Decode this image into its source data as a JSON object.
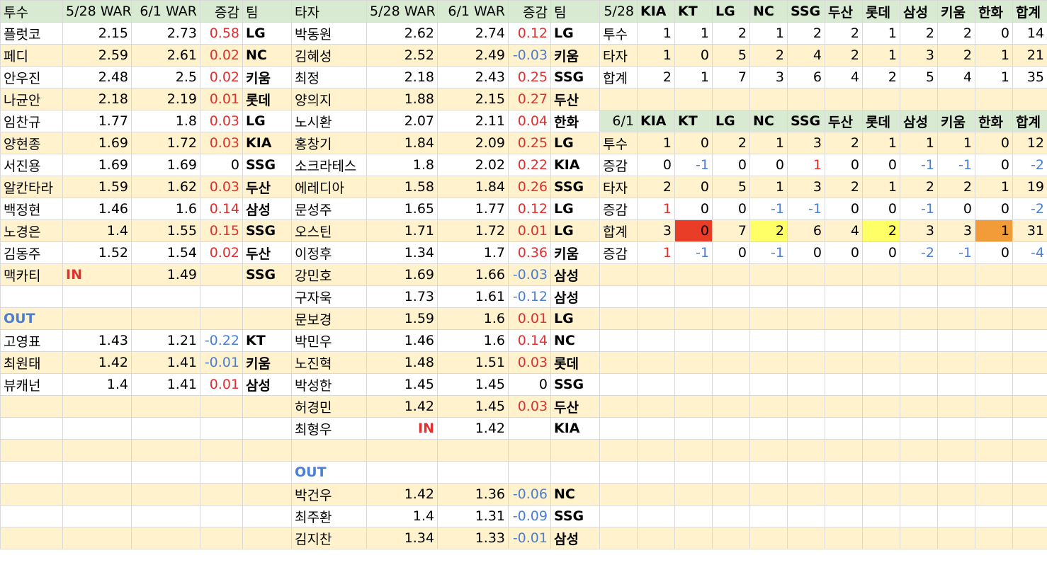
{
  "pitchers": {
    "headers": [
      "투수",
      "5/28 WAR",
      "6/1 WAR",
      "증감",
      "팀"
    ],
    "rows": [
      {
        "name": "플럿코",
        "w1": "2.15",
        "w2": "2.73",
        "diff": "0.58",
        "team": "LG"
      },
      {
        "name": "페디",
        "w1": "2.59",
        "w2": "2.61",
        "diff": "0.02",
        "team": "NC"
      },
      {
        "name": "안우진",
        "w1": "2.48",
        "w2": "2.5",
        "diff": "0.02",
        "team": "키움"
      },
      {
        "name": "나균안",
        "w1": "2.18",
        "w2": "2.19",
        "diff": "0.01",
        "team": "롯데"
      },
      {
        "name": "임찬규",
        "w1": "1.77",
        "w2": "1.8",
        "diff": "0.03",
        "team": "LG"
      },
      {
        "name": "양현종",
        "w1": "1.69",
        "w2": "1.72",
        "diff": "0.03",
        "team": "KIA"
      },
      {
        "name": "서진용",
        "w1": "1.69",
        "w2": "1.69",
        "diff": "0",
        "team": "SSG"
      },
      {
        "name": "알칸타라",
        "w1": "1.59",
        "w2": "1.62",
        "diff": "0.03",
        "team": "두산"
      },
      {
        "name": "백정현",
        "w1": "1.46",
        "w2": "1.6",
        "diff": "0.14",
        "team": "삼성"
      },
      {
        "name": "노경은",
        "w1": "1.4",
        "w2": "1.55",
        "diff": "0.15",
        "team": "SSG"
      },
      {
        "name": "김동주",
        "w1": "1.52",
        "w2": "1.54",
        "diff": "0.02",
        "team": "두산"
      },
      {
        "name": "맥카티",
        "w1": "IN",
        "w2": "1.49",
        "diff": "",
        "team": "SSG"
      }
    ],
    "out_label": "OUT",
    "out_rows": [
      {
        "name": "고영표",
        "w1": "1.43",
        "w2": "1.21",
        "diff": "-0.22",
        "team": "KT"
      },
      {
        "name": "최원태",
        "w1": "1.42",
        "w2": "1.41",
        "diff": "-0.01",
        "team": "키움"
      },
      {
        "name": "뷰캐넌",
        "w1": "1.4",
        "w2": "1.41",
        "diff": "0.01",
        "team": "삼성"
      }
    ]
  },
  "batters": {
    "headers": [
      "타자",
      "5/28 WAR",
      "6/1 WAR",
      "증감",
      "팀"
    ],
    "rows": [
      {
        "name": "박동원",
        "w1": "2.62",
        "w2": "2.74",
        "diff": "0.12",
        "team": "LG"
      },
      {
        "name": "김혜성",
        "w1": "2.52",
        "w2": "2.49",
        "diff": "-0.03",
        "team": "키움"
      },
      {
        "name": "최정",
        "w1": "2.18",
        "w2": "2.43",
        "diff": "0.25",
        "team": "SSG"
      },
      {
        "name": "양의지",
        "w1": "1.88",
        "w2": "2.15",
        "diff": "0.27",
        "team": "두산"
      },
      {
        "name": "노시환",
        "w1": "2.07",
        "w2": "2.11",
        "diff": "0.04",
        "team": "한화"
      },
      {
        "name": "홍창기",
        "w1": "1.84",
        "w2": "2.09",
        "diff": "0.25",
        "team": "LG"
      },
      {
        "name": "소크라테스",
        "w1": "1.8",
        "w2": "2.02",
        "diff": "0.22",
        "team": "KIA"
      },
      {
        "name": "에레디아",
        "w1": "1.58",
        "w2": "1.84",
        "diff": "0.26",
        "team": "SSG"
      },
      {
        "name": "문성주",
        "w1": "1.65",
        "w2": "1.77",
        "diff": "0.12",
        "team": "LG"
      },
      {
        "name": "오스틴",
        "w1": "1.71",
        "w2": "1.72",
        "diff": "0.01",
        "team": "LG"
      },
      {
        "name": "이정후",
        "w1": "1.34",
        "w2": "1.7",
        "diff": "0.36",
        "team": "키움"
      },
      {
        "name": "강민호",
        "w1": "1.69",
        "w2": "1.66",
        "diff": "-0.03",
        "team": "삼성"
      },
      {
        "name": "구자욱",
        "w1": "1.73",
        "w2": "1.61",
        "diff": "-0.12",
        "team": "삼성"
      },
      {
        "name": "문보경",
        "w1": "1.59",
        "w2": "1.6",
        "diff": "0.01",
        "team": "LG"
      },
      {
        "name": "박민우",
        "w1": "1.46",
        "w2": "1.6",
        "diff": "0.14",
        "team": "NC"
      },
      {
        "name": "노진혁",
        "w1": "1.48",
        "w2": "1.51",
        "diff": "0.03",
        "team": "롯데"
      },
      {
        "name": "박성한",
        "w1": "1.45",
        "w2": "1.45",
        "diff": "0",
        "team": "SSG"
      },
      {
        "name": "허경민",
        "w1": "1.42",
        "w2": "1.45",
        "diff": "0.03",
        "team": "두산"
      },
      {
        "name": "최형우",
        "w1": "IN",
        "w2": "1.42",
        "diff": "",
        "team": "KIA"
      }
    ],
    "out_label": "OUT",
    "out_rows": [
      {
        "name": "박건우",
        "w1": "1.42",
        "w2": "1.36",
        "diff": "-0.06",
        "team": "NC"
      },
      {
        "name": "최주환",
        "w1": "1.4",
        "w2": "1.31",
        "diff": "-0.09",
        "team": "SSG"
      },
      {
        "name": "김지찬",
        "w1": "1.34",
        "w2": "1.33",
        "diff": "-0.01",
        "team": "삼성"
      }
    ]
  },
  "summary_528": {
    "headers": [
      "5/28",
      "KIA",
      "KT",
      "LG",
      "NC",
      "SSG",
      "두산",
      "롯데",
      "삼성",
      "키움",
      "한화",
      "합계"
    ],
    "rows": [
      {
        "label": "투수",
        "values": [
          "1",
          "1",
          "2",
          "1",
          "2",
          "2",
          "1",
          "2",
          "2",
          "0",
          "14"
        ]
      },
      {
        "label": "타자",
        "values": [
          "1",
          "0",
          "5",
          "2",
          "4",
          "2",
          "1",
          "3",
          "2",
          "1",
          "21"
        ]
      },
      {
        "label": "합계",
        "values": [
          "2",
          "1",
          "7",
          "3",
          "6",
          "4",
          "2",
          "5",
          "4",
          "1",
          "35"
        ]
      }
    ]
  },
  "summary_61": {
    "headers": [
      "6/1",
      "KIA",
      "KT",
      "LG",
      "NC",
      "SSG",
      "두산",
      "롯데",
      "삼성",
      "키움",
      "한화",
      "합계"
    ],
    "rows": [
      {
        "label": "투수",
        "values": [
          "1",
          "0",
          "2",
          "1",
          "3",
          "2",
          "1",
          "1",
          "1",
          "0",
          "12"
        ]
      },
      {
        "label": "증감",
        "values": [
          "0",
          "-1",
          "0",
          "0",
          "1",
          "0",
          "0",
          "-1",
          "-1",
          "0",
          "-2"
        ]
      },
      {
        "label": "타자",
        "values": [
          "2",
          "0",
          "5",
          "1",
          "3",
          "2",
          "1",
          "2",
          "2",
          "1",
          "19"
        ]
      },
      {
        "label": "증감",
        "values": [
          "1",
          "0",
          "0",
          "-1",
          "-1",
          "0",
          "0",
          "-1",
          "0",
          "0",
          "-2"
        ]
      },
      {
        "label": "합계",
        "values": [
          "3",
          "0",
          "7",
          "2",
          "6",
          "4",
          "2",
          "3",
          "3",
          "1",
          "31"
        ]
      },
      {
        "label": "증감",
        "values": [
          "1",
          "-1",
          "0",
          "-1",
          "0",
          "0",
          "0",
          "-2",
          "-1",
          "0",
          "-4"
        ]
      }
    ]
  },
  "highlight_colors": {
    "red": "#ea3d28",
    "yellow": "#ffff66",
    "orange": "#f19c38",
    "header_green": "#d9ead3",
    "row_yellow": "#fff2cc"
  }
}
